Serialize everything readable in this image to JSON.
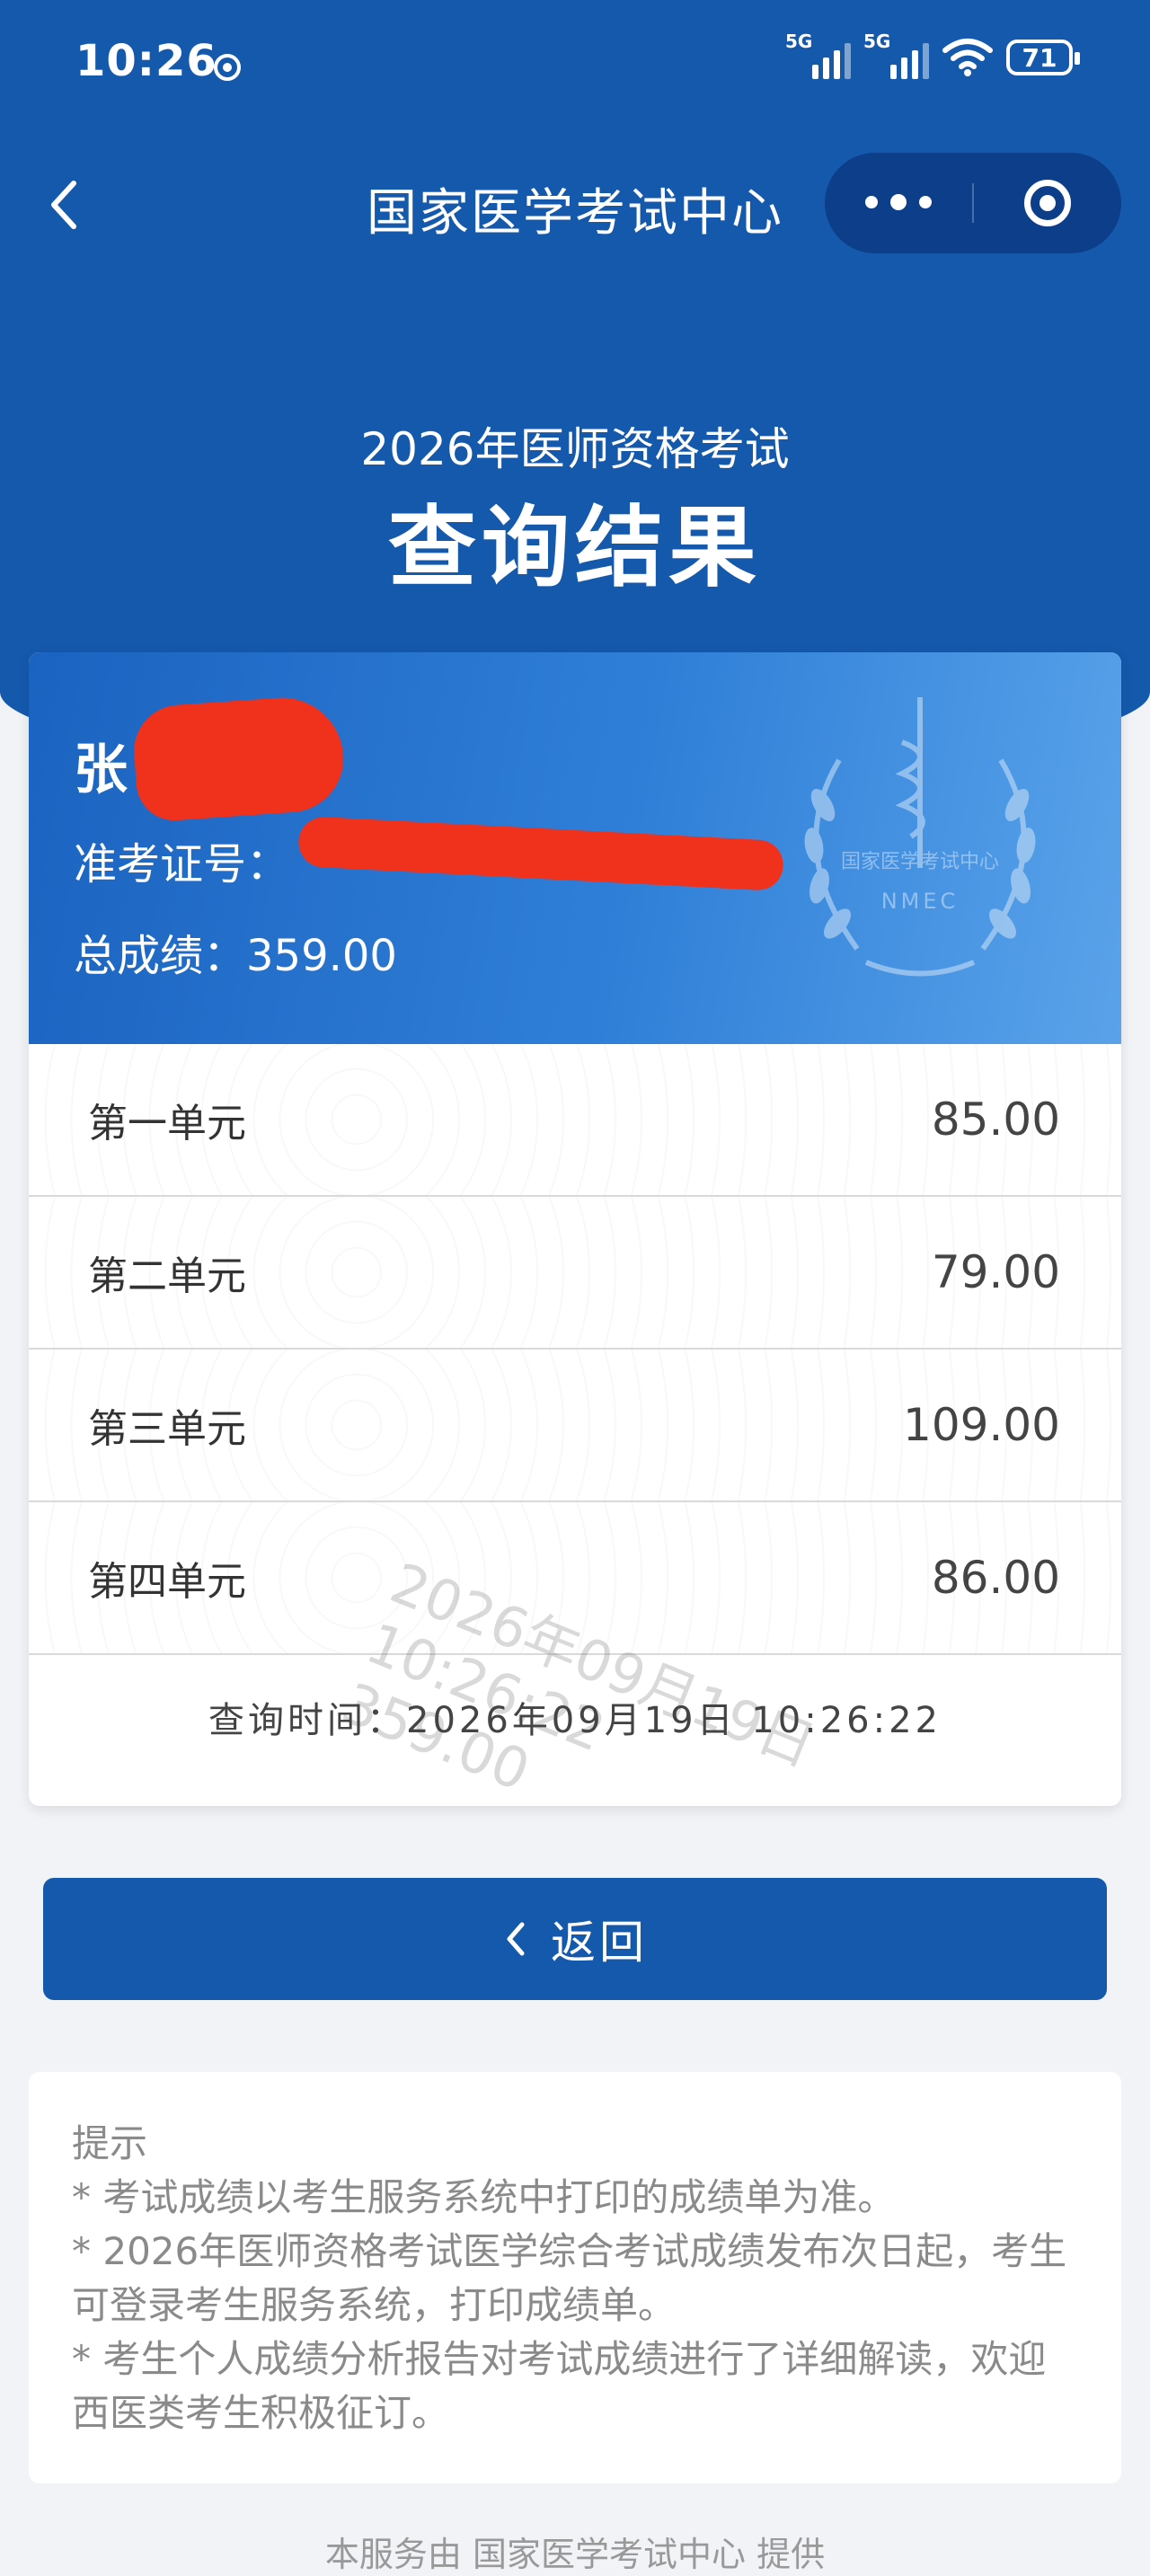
{
  "status": {
    "time": "10:26",
    "signal1": "5G",
    "signal2": "5G",
    "battery": "71"
  },
  "nav": {
    "title": "国家医学考试中心"
  },
  "hero": {
    "subtitle": "2026年医师资格考试",
    "title": "查询结果"
  },
  "candidate": {
    "name": "张",
    "id_label": "准考证号：",
    "total_label": "总成绩：",
    "total_value": "359.00"
  },
  "emblem": {
    "text_cn": "国家医学考试中心",
    "text_en": "NMEC"
  },
  "units": [
    {
      "name": "第一单元",
      "score": "85.00"
    },
    {
      "name": "第二单元",
      "score": "79.00"
    },
    {
      "name": "第三单元",
      "score": "109.00"
    },
    {
      "name": "第四单元",
      "score": "86.00"
    }
  ],
  "watermark": {
    "line1": "2026年09月19日",
    "line2": "10:26:22",
    "line3": "359.00"
  },
  "query": {
    "label": "查询时间：",
    "value": "2026年09月19日 10:26:22"
  },
  "back_button": {
    "label": "返回"
  },
  "notice": {
    "title": "提示",
    "items": [
      "* 考试成绩以考生服务系统中打印的成绩单为准。",
      "* 2026年医师资格考试医学综合考试成绩发布次日起，考生可登录考生服务系统，打印成绩单。",
      "* 考生个人成绩分析报告对考试成绩进行了详细解读，欢迎西医类考生积极征订。"
    ]
  },
  "footer": {
    "text": "本服务由 国家医学考试中心 提供"
  },
  "colors": {
    "primary": "#1559ad",
    "card_gradient_end": "#5aa3ea",
    "redaction": "#f0311c"
  }
}
